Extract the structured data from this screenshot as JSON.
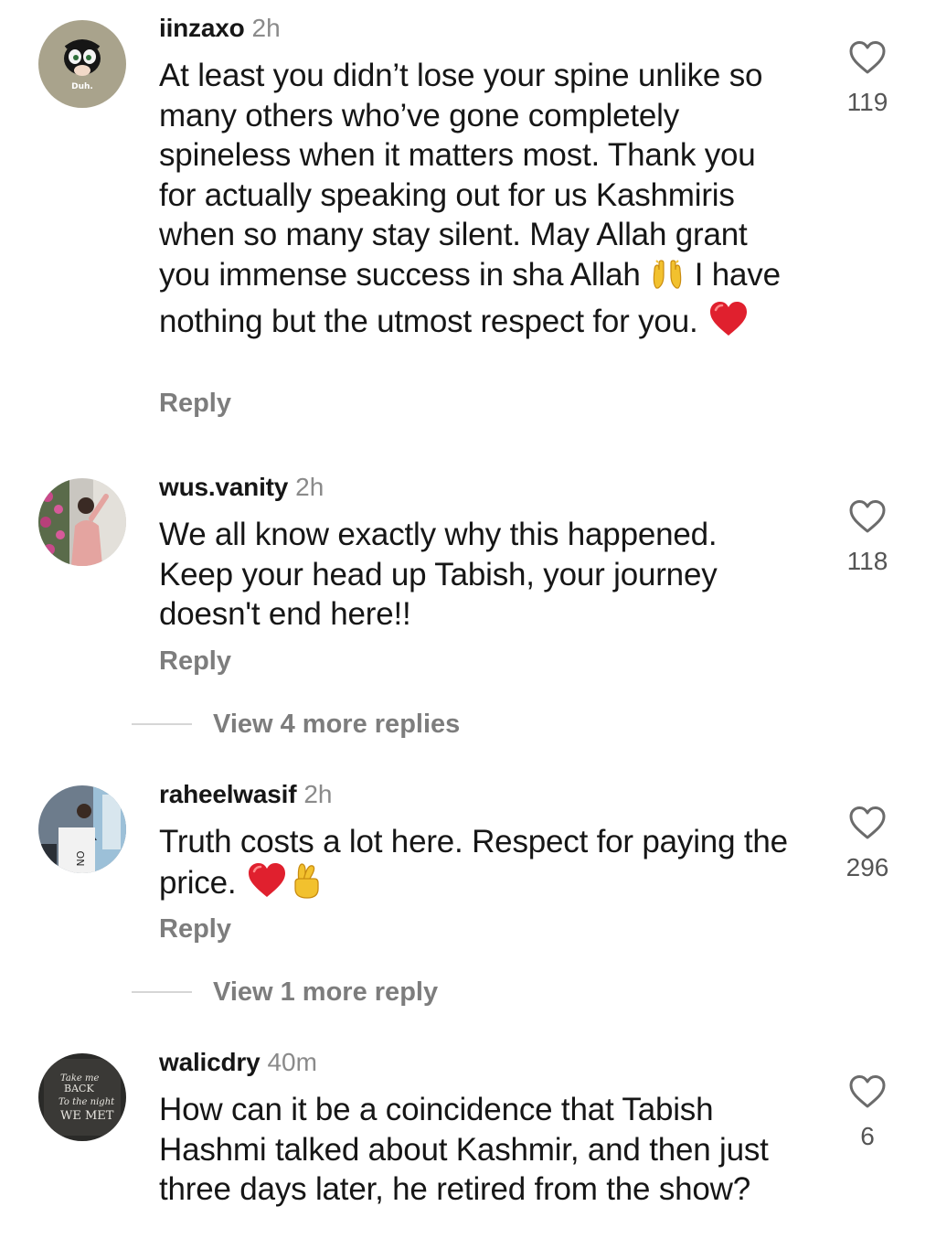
{
  "comments": [
    {
      "username": "iinzaxo",
      "time": "2h",
      "avatar_label": "Duh.",
      "text_parts": [
        "At least you didn’t lose your spine unlike so many others who’ve gone completely spineless when it matters most. Thank you for actually speaking out for us Kashmiris when so many stay silent. May Allah grant you immense success in sha Allah ",
        " I have nothing but the utmost respect for you. "
      ],
      "emojis": [
        "raised-hands-emoji",
        "red-heart-emoji"
      ],
      "reply_label": "Reply",
      "likes": "119"
    },
    {
      "username": "wus.vanity",
      "time": "2h",
      "text": "We all know exactly why this happened. Keep your head up Tabish, your journey doesn't end here!!",
      "reply_label": "Reply",
      "likes": "118",
      "view_more": "View 4 more replies"
    },
    {
      "username": "raheelwasif",
      "time": "2h",
      "text_parts": [
        "Truth costs a lot here. Respect for paying the price. "
      ],
      "emojis": [
        "red-heart-emoji",
        "crossed-fingers-emoji"
      ],
      "reply_label": "Reply",
      "likes": "296",
      "view_more": "View 1 more reply"
    },
    {
      "username": "walicdry",
      "time": "40m",
      "avatar_label": [
        "Take me",
        "BACK",
        "To the night",
        "WE MET"
      ],
      "text": "How can it be a coincidence that Tabish Hashmi talked about Kashmir, and then just three days later, he retired from the show?",
      "likes": "6"
    }
  ],
  "icons": {
    "like": "heart-outline-icon"
  },
  "colors": {
    "text": "#161616",
    "muted": "#8a8a8a",
    "reply": "#7d7d7d",
    "heart_emoji": "#e0202e",
    "divider": "#d6d6d6"
  }
}
